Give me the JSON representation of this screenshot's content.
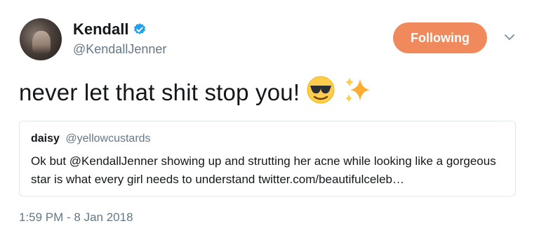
{
  "author": {
    "display_name": "Kendall",
    "handle": "@KendallJenner",
    "verified": true,
    "avatar": "profile-photo"
  },
  "actions": {
    "follow_label": "Following",
    "menu_icon": "chevron-down-icon"
  },
  "tweet": {
    "text": "never let that shit stop you!",
    "emojis": [
      "smiling-face-with-sunglasses",
      "sparkles"
    ]
  },
  "quoted_tweet": {
    "display_name": "daisy",
    "handle": "@yellowcustards",
    "text": "Ok but @KendallJenner showing up and strutting her acne while looking like a gorgeous star is what every girl needs to understand twitter.com/beautifulceleb…"
  },
  "timestamp": "1:59 PM - 8 Jan 2018",
  "colors": {
    "follow_button": "#f08a5d",
    "verified_badge": "#1da1f2",
    "secondary_text": "#657786",
    "border": "#e1e8ed"
  }
}
